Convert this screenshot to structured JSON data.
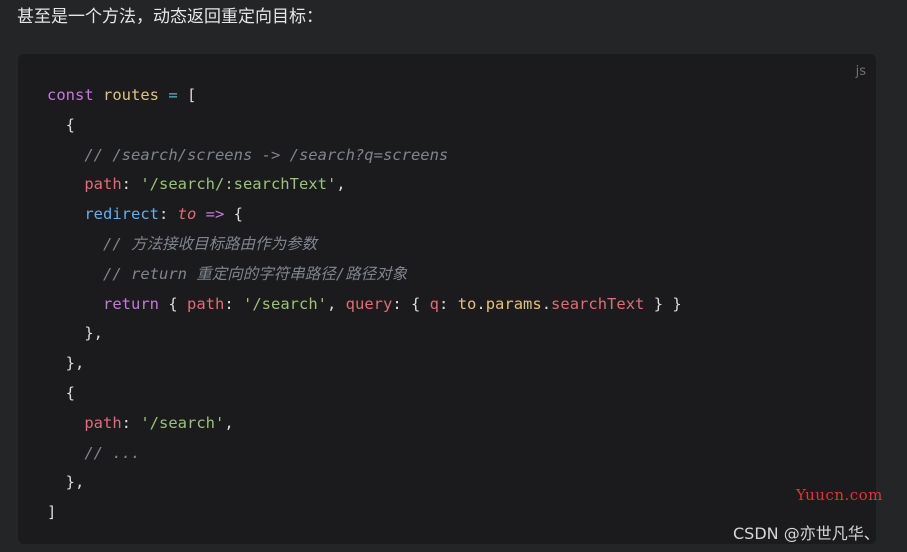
{
  "heading": "甚至是一个方法，动态返回重定向目标：",
  "code_block": {
    "language": "js",
    "lines": [
      [
        {
          "t": "const",
          "c": "kw"
        },
        {
          "t": " ",
          "c": "pun"
        },
        {
          "t": "routes",
          "c": "var"
        },
        {
          "t": " = ",
          "c": "op"
        },
        {
          "t": "[",
          "c": "pun"
        }
      ],
      [
        {
          "t": "  {",
          "c": "pun"
        }
      ],
      [
        {
          "t": "    // /search/screens -> /search?q=screens",
          "c": "com"
        }
      ],
      [
        {
          "t": "    ",
          "c": "pun"
        },
        {
          "t": "path",
          "c": "key"
        },
        {
          "t": ": ",
          "c": "pun"
        },
        {
          "t": "'/search/:searchText'",
          "c": "str"
        },
        {
          "t": ",",
          "c": "pun"
        }
      ],
      [
        {
          "t": "    ",
          "c": "pun"
        },
        {
          "t": "redirect",
          "c": "fn"
        },
        {
          "t": ": ",
          "c": "pun"
        },
        {
          "t": "to",
          "c": "par"
        },
        {
          "t": " => ",
          "c": "kw"
        },
        {
          "t": "{",
          "c": "pun"
        }
      ],
      [
        {
          "t": "      // 方法接收目标路由作为参数",
          "c": "com"
        }
      ],
      [
        {
          "t": "      // return 重定向的字符串路径/路径对象",
          "c": "com"
        }
      ],
      [
        {
          "t": "      ",
          "c": "pun"
        },
        {
          "t": "return",
          "c": "kw"
        },
        {
          "t": " { ",
          "c": "pun"
        },
        {
          "t": "path",
          "c": "key"
        },
        {
          "t": ": ",
          "c": "pun"
        },
        {
          "t": "'/search'",
          "c": "str"
        },
        {
          "t": ", ",
          "c": "pun"
        },
        {
          "t": "query",
          "c": "key"
        },
        {
          "t": ": { ",
          "c": "pun"
        },
        {
          "t": "q",
          "c": "key"
        },
        {
          "t": ": ",
          "c": "pun"
        },
        {
          "t": "to",
          "c": "var"
        },
        {
          "t": ".",
          "c": "pun"
        },
        {
          "t": "params",
          "c": "prop"
        },
        {
          "t": ".",
          "c": "pun"
        },
        {
          "t": "searchText",
          "c": "key"
        },
        {
          "t": " } }",
          "c": "pun"
        }
      ],
      [
        {
          "t": "    },",
          "c": "pun"
        }
      ],
      [
        {
          "t": "  },",
          "c": "pun"
        }
      ],
      [
        {
          "t": "  {",
          "c": "pun"
        }
      ],
      [
        {
          "t": "    ",
          "c": "pun"
        },
        {
          "t": "path",
          "c": "key"
        },
        {
          "t": ": ",
          "c": "pun"
        },
        {
          "t": "'/search'",
          "c": "str"
        },
        {
          "t": ",",
          "c": "pun"
        }
      ],
      [
        {
          "t": "    // ...",
          "c": "com"
        }
      ],
      [
        {
          "t": "  },",
          "c": "pun"
        }
      ],
      [
        {
          "t": "]",
          "c": "pun"
        }
      ]
    ]
  },
  "watermarks": {
    "yuucn": "Yuucn.com",
    "csdn": "CSDN @亦世凡华、"
  },
  "colors": {
    "page_background": "#242526",
    "code_background": "#1b1b1d",
    "keyword": "#c678dd",
    "variable": "#e5c07b",
    "string": "#98c379",
    "property_key": "#e06c75",
    "function": "#61afef",
    "comment": "#7f848e",
    "watermark_red": "#e0362f"
  }
}
